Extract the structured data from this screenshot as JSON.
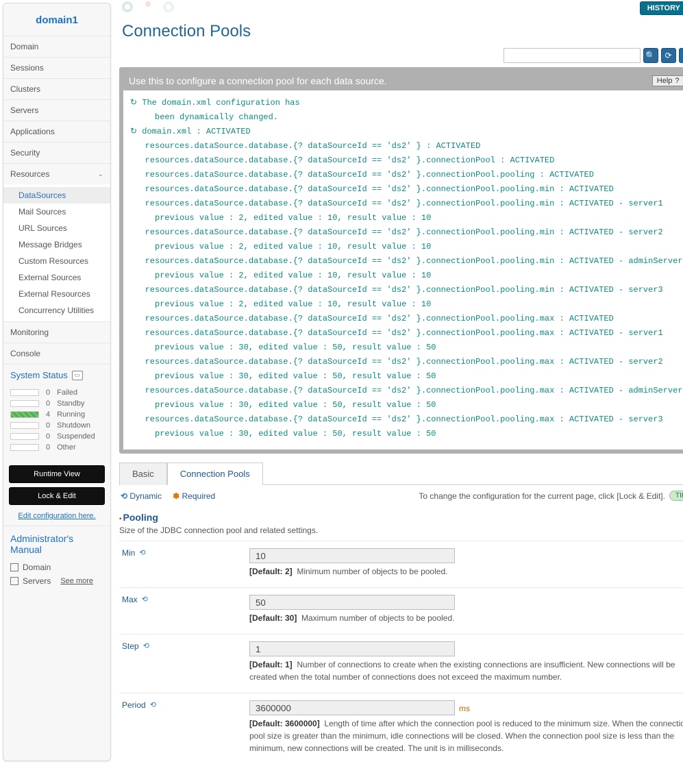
{
  "domain_title": "domain1",
  "nav": {
    "items": [
      "Domain",
      "Sessions",
      "Clusters",
      "Servers",
      "Applications",
      "Security",
      "Resources",
      "Monitoring",
      "Console"
    ],
    "resources_sub": [
      "DataSources",
      "Mail Sources",
      "URL Sources",
      "Message Bridges",
      "Custom Resources",
      "External Sources",
      "External Resources",
      "Concurrency Utilities"
    ]
  },
  "system_status": {
    "title": "System Status",
    "rows": [
      {
        "count": "0",
        "label": "Failed",
        "g": false
      },
      {
        "count": "0",
        "label": "Standby",
        "g": false
      },
      {
        "count": "4",
        "label": "Running",
        "g": true
      },
      {
        "count": "0",
        "label": "Shutdown",
        "g": false
      },
      {
        "count": "0",
        "label": "Suspended",
        "g": false
      },
      {
        "count": "0",
        "label": "Other",
        "g": false
      }
    ]
  },
  "buttons": {
    "runtime": "Runtime View",
    "lock": "Lock & Edit",
    "editlink": "Edit configuration here."
  },
  "manual": {
    "title": "Administrator's Manual",
    "i1": "Domain",
    "i2": "Servers",
    "see": "See more"
  },
  "history_btn": "HISTORY",
  "page_title": "Connection Pools",
  "panel_title": "Use this to configure a connection pool for each data source.",
  "help_label": "Help",
  "log_lines": [
    "↻ The domain.xml configuration has",
    "     been dynamically changed.",
    "↻ domain.xml : ACTIVATED",
    "   resources.dataSource.database.{? dataSourceId == 'ds2' } : ACTIVATED",
    "   resources.dataSource.database.{? dataSourceId == 'ds2' }.connectionPool : ACTIVATED",
    "   resources.dataSource.database.{? dataSourceId == 'ds2' }.connectionPool.pooling : ACTIVATED",
    "   resources.dataSource.database.{? dataSourceId == 'ds2' }.connectionPool.pooling.min : ACTIVATED",
    "   resources.dataSource.database.{? dataSourceId == 'ds2' }.connectionPool.pooling.min : ACTIVATED - server1",
    "     previous value : 2, edited value : 10, result value : 10",
    "   resources.dataSource.database.{? dataSourceId == 'ds2' }.connectionPool.pooling.min : ACTIVATED - server2",
    "     previous value : 2, edited value : 10, result value : 10",
    "   resources.dataSource.database.{? dataSourceId == 'ds2' }.connectionPool.pooling.min : ACTIVATED - adminServer",
    "     previous value : 2, edited value : 10, result value : 10",
    "   resources.dataSource.database.{? dataSourceId == 'ds2' }.connectionPool.pooling.min : ACTIVATED - server3",
    "     previous value : 2, edited value : 10, result value : 10",
    "   resources.dataSource.database.{? dataSourceId == 'ds2' }.connectionPool.pooling.max : ACTIVATED",
    "   resources.dataSource.database.{? dataSourceId == 'ds2' }.connectionPool.pooling.max : ACTIVATED - server1",
    "     previous value : 30, edited value : 50, result value : 50",
    "   resources.dataSource.database.{? dataSourceId == 'ds2' }.connectionPool.pooling.max : ACTIVATED - server2",
    "     previous value : 30, edited value : 50, result value : 50",
    "   resources.dataSource.database.{? dataSourceId == 'ds2' }.connectionPool.pooling.max : ACTIVATED - adminServer",
    "     previous value : 30, edited value : 50, result value : 50",
    "   resources.dataSource.database.{? dataSourceId == 'ds2' }.connectionPool.pooling.max : ACTIVATED - server3",
    "     previous value : 30, edited value : 50, result value : 50"
  ],
  "tabs": {
    "basic": "Basic",
    "pools": "Connection Pools"
  },
  "legend": {
    "dynamic": "Dynamic",
    "required": "Required"
  },
  "tip_line": "To change the configuration for the current page, click [Lock & Edit].",
  "tip": "TIP",
  "section": {
    "title": "Pooling",
    "sub": "Size of the JDBC connection pool and related settings."
  },
  "fields": {
    "min": {
      "label": "Min",
      "value": "10",
      "default": "[Default: 2]",
      "hint": "Minimum number of objects to be pooled."
    },
    "max": {
      "label": "Max",
      "value": "50",
      "default": "[Default: 30]",
      "hint": "Maximum number of objects to be pooled."
    },
    "step": {
      "label": "Step",
      "value": "1",
      "default": "[Default: 1]",
      "hint": "Number of connections to create when the existing connections are insufficient. New connections will be created when the total number of connections does not exceed the maximum number."
    },
    "period": {
      "label": "Period",
      "value": "3600000",
      "unit": "ms",
      "default": "[Default: 3600000]",
      "hint": "Length of time after which the connection pool is reduced to the minimum size. When the connection pool size is greater than the minimum, idle connections will be closed. When the connection pool size is less than the minimum, new connections will be created. The unit is in milliseconds."
    }
  }
}
